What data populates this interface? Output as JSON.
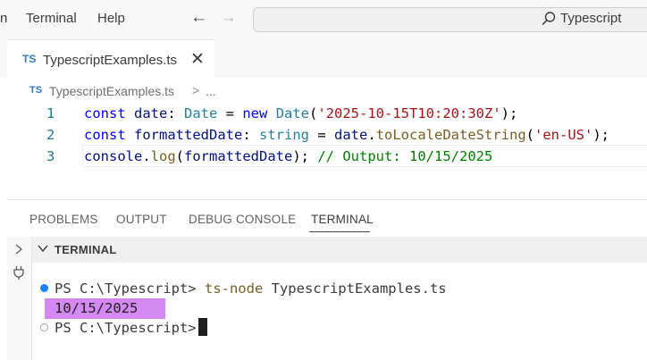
{
  "menu": {
    "partial_item": "n",
    "terminal": "Terminal",
    "help": "Help"
  },
  "nav": {
    "back_glyph": "←",
    "forward_glyph": "→"
  },
  "search": {
    "text": "Typescript"
  },
  "tab": {
    "badge": "TS",
    "label": "TypescriptExamples.ts",
    "close_glyph": "✕"
  },
  "breadcrumb": {
    "badge": "TS",
    "file": "TypescriptExamples.ts",
    "separator": ">",
    "more": "..."
  },
  "editor": {
    "line_numbers": [
      "1",
      "2",
      "3"
    ],
    "line1": {
      "kw": "const",
      "name": "date",
      "colon": ": ",
      "type": "Date",
      "eq": " = ",
      "new": "new",
      "ctor": "Date",
      "open": "(",
      "str": "'2025-10-15T10:20:30Z'",
      "close": ");"
    },
    "line2": {
      "kw": "const",
      "name": "formattedDate",
      "colon": ": ",
      "type": "string",
      "eq": " = ",
      "obj": "date",
      "dot": ".",
      "method": "toLocaleDateString",
      "open": "(",
      "str": "'en-US'",
      "close": ");"
    },
    "line3": {
      "obj": "console",
      "dot": ".",
      "method": "log",
      "open": "(",
      "arg": "formattedDate",
      "close": "); ",
      "comment": "// Output: 10/15/2025"
    }
  },
  "panel": {
    "tabs": [
      "PROBLEMS",
      "OUTPUT",
      "DEBUG CONSOLE",
      "TERMINAL"
    ],
    "active_tab": "TERMINAL",
    "terminal_header": "TERMINAL"
  },
  "terminal": {
    "prompt1": "PS C:\\Typescript> ",
    "command": "ts-node",
    "command_arg": " TypescriptExamples.ts",
    "output": "10/15/2025",
    "prompt2": "PS C:\\Typescript> "
  },
  "colors": {
    "highlight": "#d488f2",
    "ts_badge": "#3178c6",
    "keyword": "#0000ff",
    "string": "#a31515",
    "comment": "#008000"
  }
}
